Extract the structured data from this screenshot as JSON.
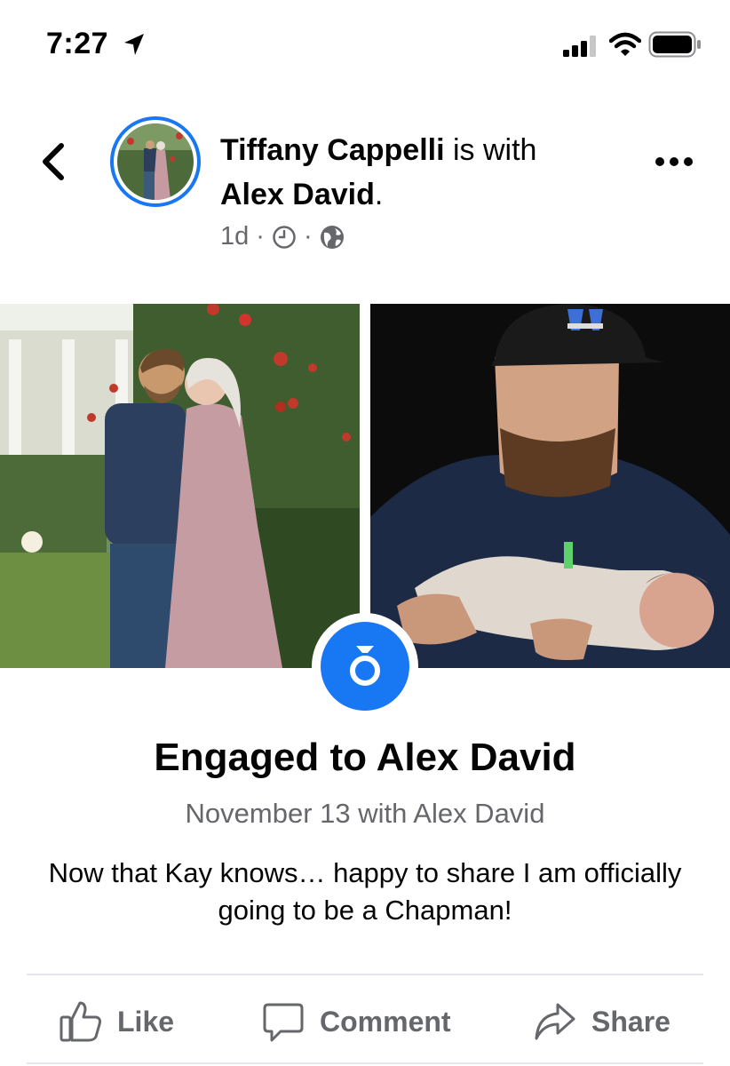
{
  "status_bar": {
    "time": "7:27"
  },
  "post": {
    "author": "Tiffany Cappelli",
    "with_text": " is with",
    "tagged": "Alex David",
    "tagged_suffix": ".",
    "age": "1d",
    "separator": "·",
    "icons": [
      "back-chevron-icon",
      "clock-icon",
      "globe-icon",
      "more-dots-icon"
    ]
  },
  "life_event": {
    "icon": "engagement-ring-icon",
    "title": "Engaged to Alex David",
    "subtitle": "November 13 with Alex David",
    "text": "Now that Kay knows… happy to share I am officially going to be a Chapman!"
  },
  "actions": {
    "like": "Like",
    "comment": "Comment",
    "share": "Share"
  },
  "colors": {
    "accent": "#1877f2",
    "secondary_text": "#65676b",
    "primary_text": "#050505"
  }
}
